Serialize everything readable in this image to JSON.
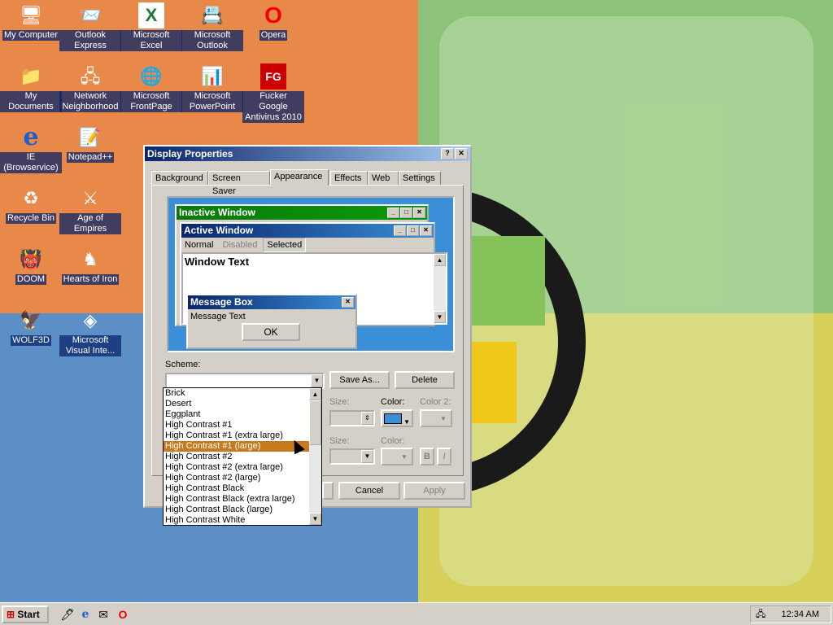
{
  "desktop": {
    "icons": [
      {
        "label": "My Computer",
        "glyph": "🖥"
      },
      {
        "label": "Outlook Express",
        "glyph": "📨"
      },
      {
        "label": "Microsoft Excel",
        "glyph": "X"
      },
      {
        "label": "Microsoft Outlook",
        "glyph": "📇"
      },
      {
        "label": "Opera",
        "glyph": "O"
      },
      {
        "label": "My Documents",
        "glyph": "📁"
      },
      {
        "label": "Network Neighborhood",
        "glyph": "🖧"
      },
      {
        "label": "Microsoft FrontPage",
        "glyph": "🌐"
      },
      {
        "label": "Microsoft PowerPoint",
        "glyph": "📊"
      },
      {
        "label": "Fucker Google Antivirus 2010",
        "glyph": "FG"
      },
      {
        "label": "IE (Browservice)",
        "glyph": "e"
      },
      {
        "label": "Notepad++",
        "glyph": "📝"
      },
      {
        "label": "Recycle Bin",
        "glyph": "♻"
      },
      {
        "label": "Age of Empires",
        "glyph": "⚔"
      },
      {
        "label": "DOOM",
        "glyph": "👹"
      },
      {
        "label": "Hearts of Iron",
        "glyph": "♞"
      },
      {
        "label": "WOLF3D",
        "glyph": "🦅"
      },
      {
        "label": "Microsoft Visual Inte...",
        "glyph": "◈"
      }
    ]
  },
  "dialog": {
    "title": "Display Properties",
    "help": "?",
    "close": "✕",
    "tabs": [
      "Background",
      "Screen Saver",
      "Appearance",
      "Effects",
      "Web",
      "Settings"
    ],
    "active_tab": "Appearance",
    "preview": {
      "inactive_title": "Inactive Window",
      "active_title": "Active Window",
      "menu_normal": "Normal",
      "menu_disabled": "Disabled",
      "menu_selected": "Selected",
      "window_text": "Window Text",
      "msgbox_title": "Message Box",
      "msgbox_text": "Message Text",
      "ok": "OK"
    },
    "scheme_label": "Scheme:",
    "scheme_value": "",
    "save_as": "Save As...",
    "delete": "Delete",
    "size_label": "Size:",
    "color_label": "Color:",
    "color2_label": "Color 2:",
    "size2_label": "Size:",
    "color3_label": "Color:",
    "bold": "B",
    "italic": "I",
    "cancel": "Cancel",
    "apply": "Apply",
    "color_swatch": "#3a8fd8",
    "scheme_options": [
      "Brick",
      "Desert",
      "Eggplant",
      "High Contrast #1",
      "High Contrast #1 (extra large)",
      "High Contrast #1 (large)",
      "High Contrast #2",
      "High Contrast #2 (extra large)",
      "High Contrast #2 (large)",
      "High Contrast Black",
      "High Contrast Black (extra large)",
      "High Contrast Black (large)",
      "High Contrast White"
    ],
    "selected_option": "High Contrast #1 (large)"
  },
  "taskbar": {
    "start": "Start",
    "clock": "12:34 AM"
  }
}
